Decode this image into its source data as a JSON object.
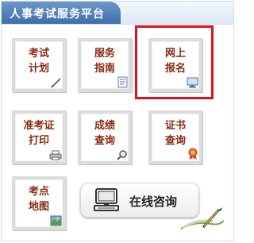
{
  "header": {
    "title": "人事考试服务平台"
  },
  "tiles": [
    {
      "line1": "考试",
      "line2": "计划",
      "icon": "pen-icon"
    },
    {
      "line1": "服务",
      "line2": "指南",
      "icon": "document-icon"
    },
    {
      "line1": "网上",
      "line2": "报名",
      "icon": "monitor-icon"
    },
    {
      "line1": "准考证",
      "line2": "打印",
      "icon": "printer-icon"
    },
    {
      "line1": "成绩",
      "line2": "查询",
      "icon": "magnifier-icon"
    },
    {
      "line1": "证书",
      "line2": "查询",
      "icon": "ribbon-seal-icon"
    },
    {
      "line1": "考点",
      "line2": "地图",
      "icon": "map-icon"
    }
  ],
  "consult": {
    "label": "在线咨询",
    "icon": "computer-icon"
  },
  "colors": {
    "tile_text": "#8a2c12",
    "highlight": "#e01218",
    "header": "#4a78b0"
  }
}
